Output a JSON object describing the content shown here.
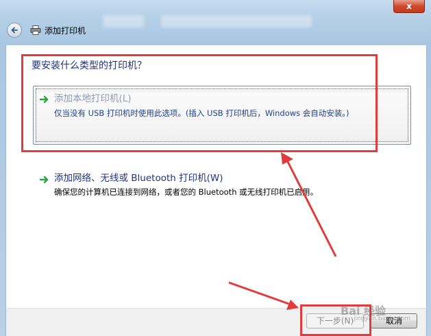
{
  "window": {
    "title": "添加打印机",
    "close_label": "x",
    "frame_color": "#b5cfe7"
  },
  "heading": "要安装什么类型的打印机？",
  "options": [
    {
      "title": "添加本地打印机(L)",
      "description": "仅当没有 USB 打印机时使用此选项。(插入 USB 打印机后，Windows 会自动安装。)",
      "icon": "green-arrow-icon",
      "selected": true
    },
    {
      "title": "添加网络、无线或 Bluetooth 打印机(W)",
      "description": "确保您的计算机已连接到网络，或者您的 Bluetooth 或无线打印机已启用。",
      "icon": "green-arrow-icon",
      "selected": false
    }
  ],
  "buttons": {
    "next": "下一步(N)",
    "cancel": "取消"
  },
  "watermark": {
    "text": "Bai 经验",
    "sub": "jingyan.baidu.com"
  },
  "colors": {
    "annotation": "#e23b3b",
    "link_blue": "#1e3287",
    "arrow_green": "#2ea043"
  }
}
